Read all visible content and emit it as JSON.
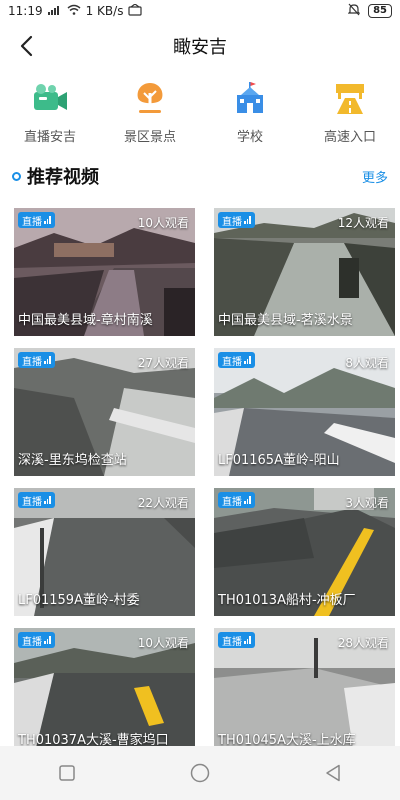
{
  "status_bar": {
    "time": "11:19",
    "net_speed": "1 KB/s",
    "battery": "85"
  },
  "header": {
    "title": "瞰安吉"
  },
  "quick_nav": [
    {
      "label": "直播安吉",
      "icon": "video-camera-icon",
      "color": "#3dbb8a"
    },
    {
      "label": "景区景点",
      "icon": "tree-icon",
      "color": "#f39a3a"
    },
    {
      "label": "学校",
      "icon": "school-building-icon",
      "color": "#3a8ee6"
    },
    {
      "label": "高速入口",
      "icon": "highway-icon",
      "color": "#f2b92c"
    }
  ],
  "section": {
    "title": "推荐视频",
    "more": "更多"
  },
  "live_label": "直播",
  "videos": [
    {
      "title": "中国最美县域-章村南溪",
      "viewers": "10人观看"
    },
    {
      "title": "中国最美县域-茗溪水景",
      "viewers": "12人观看"
    },
    {
      "title": "深溪-里东坞检查站",
      "viewers": "27人观看"
    },
    {
      "title": "LF01165A董岭-阳山",
      "viewers": "8人观看"
    },
    {
      "title": "LF01159A董岭-村委",
      "viewers": "22人观看"
    },
    {
      "title": "TH01013A船村-冲板厂",
      "viewers": "3人观看"
    },
    {
      "title": "TH01037A大溪-曹家坞口",
      "viewers": "10人观看"
    },
    {
      "title": "TH01045A大溪-上水库",
      "viewers": "28人观看"
    }
  ]
}
